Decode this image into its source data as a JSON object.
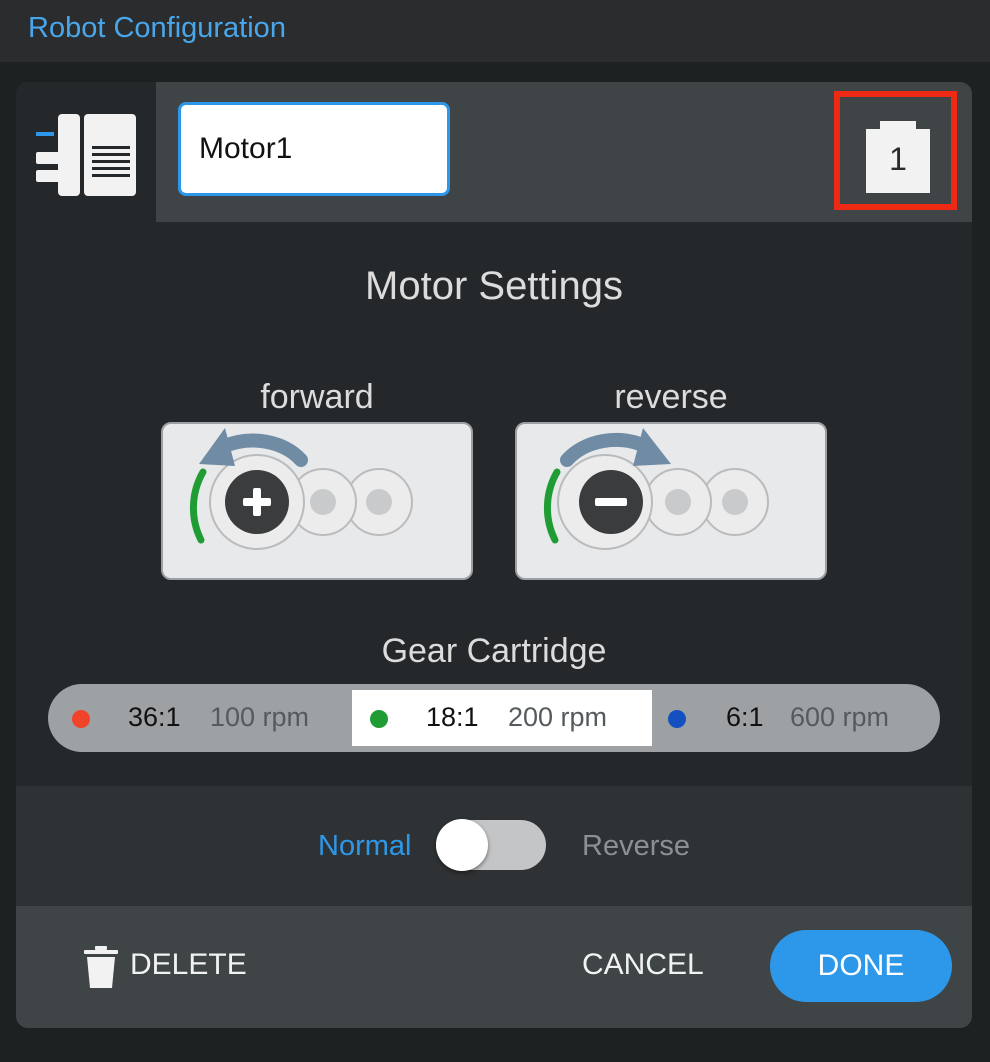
{
  "app": {
    "title": "Robot Configuration"
  },
  "device": {
    "name_value": "Motor1",
    "port": "1"
  },
  "settings": {
    "title": "Motor Settings"
  },
  "direction": {
    "forward_label": "forward",
    "reverse_label": "reverse",
    "forward_icon": "plus-icon",
    "reverse_icon": "minus-icon"
  },
  "gear": {
    "title": "Gear Cartridge",
    "options": [
      {
        "ratio": "36:1",
        "rpm": "100 rpm",
        "color": "#f0442a"
      },
      {
        "ratio": "18:1",
        "rpm": "200 rpm",
        "color": "#1f9d34",
        "selected": true
      },
      {
        "ratio": "6:1",
        "rpm": "600 rpm",
        "color": "#1550c0"
      }
    ]
  },
  "polarity": {
    "normal_label": "Normal",
    "reverse_label": "Reverse",
    "value": "Normal"
  },
  "footer": {
    "delete_label": "DELETE",
    "cancel_label": "CANCEL",
    "done_label": "DONE"
  },
  "colors": {
    "accent": "#2d98ea",
    "highlight": "#ef2a14",
    "green_arc": "#1f9d34"
  }
}
